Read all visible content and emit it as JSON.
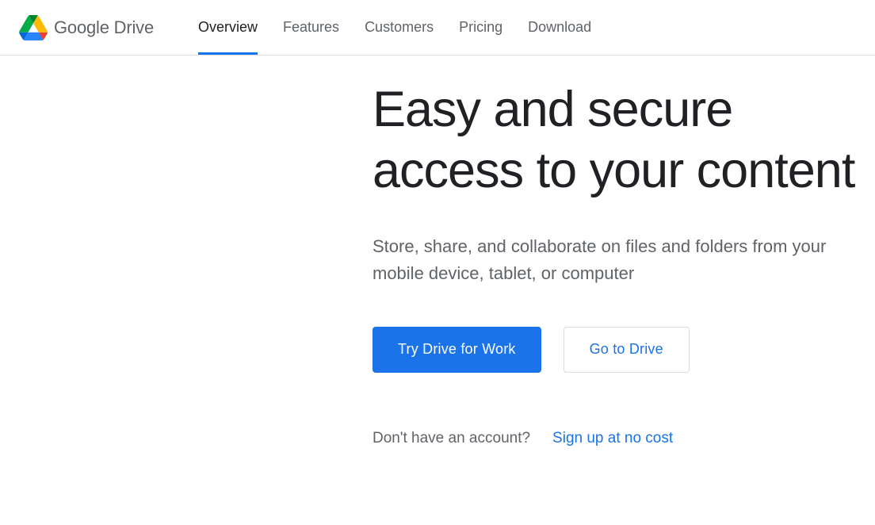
{
  "brand": {
    "google": "Google",
    "drive": " Drive"
  },
  "nav": {
    "items": [
      {
        "label": "Overview",
        "active": true
      },
      {
        "label": "Features",
        "active": false
      },
      {
        "label": "Customers",
        "active": false
      },
      {
        "label": "Pricing",
        "active": false
      },
      {
        "label": "Download",
        "active": false
      }
    ]
  },
  "hero": {
    "heading": "Easy and secure access to your content",
    "sub": "Store, share, and collaborate on files and folders from your mobile device, tablet, or computer",
    "primary_label": "Try Drive for Work",
    "secondary_label": "Go to Drive",
    "signup_question": "Don't have an account?",
    "signup_link": "Sign up at no cost"
  }
}
